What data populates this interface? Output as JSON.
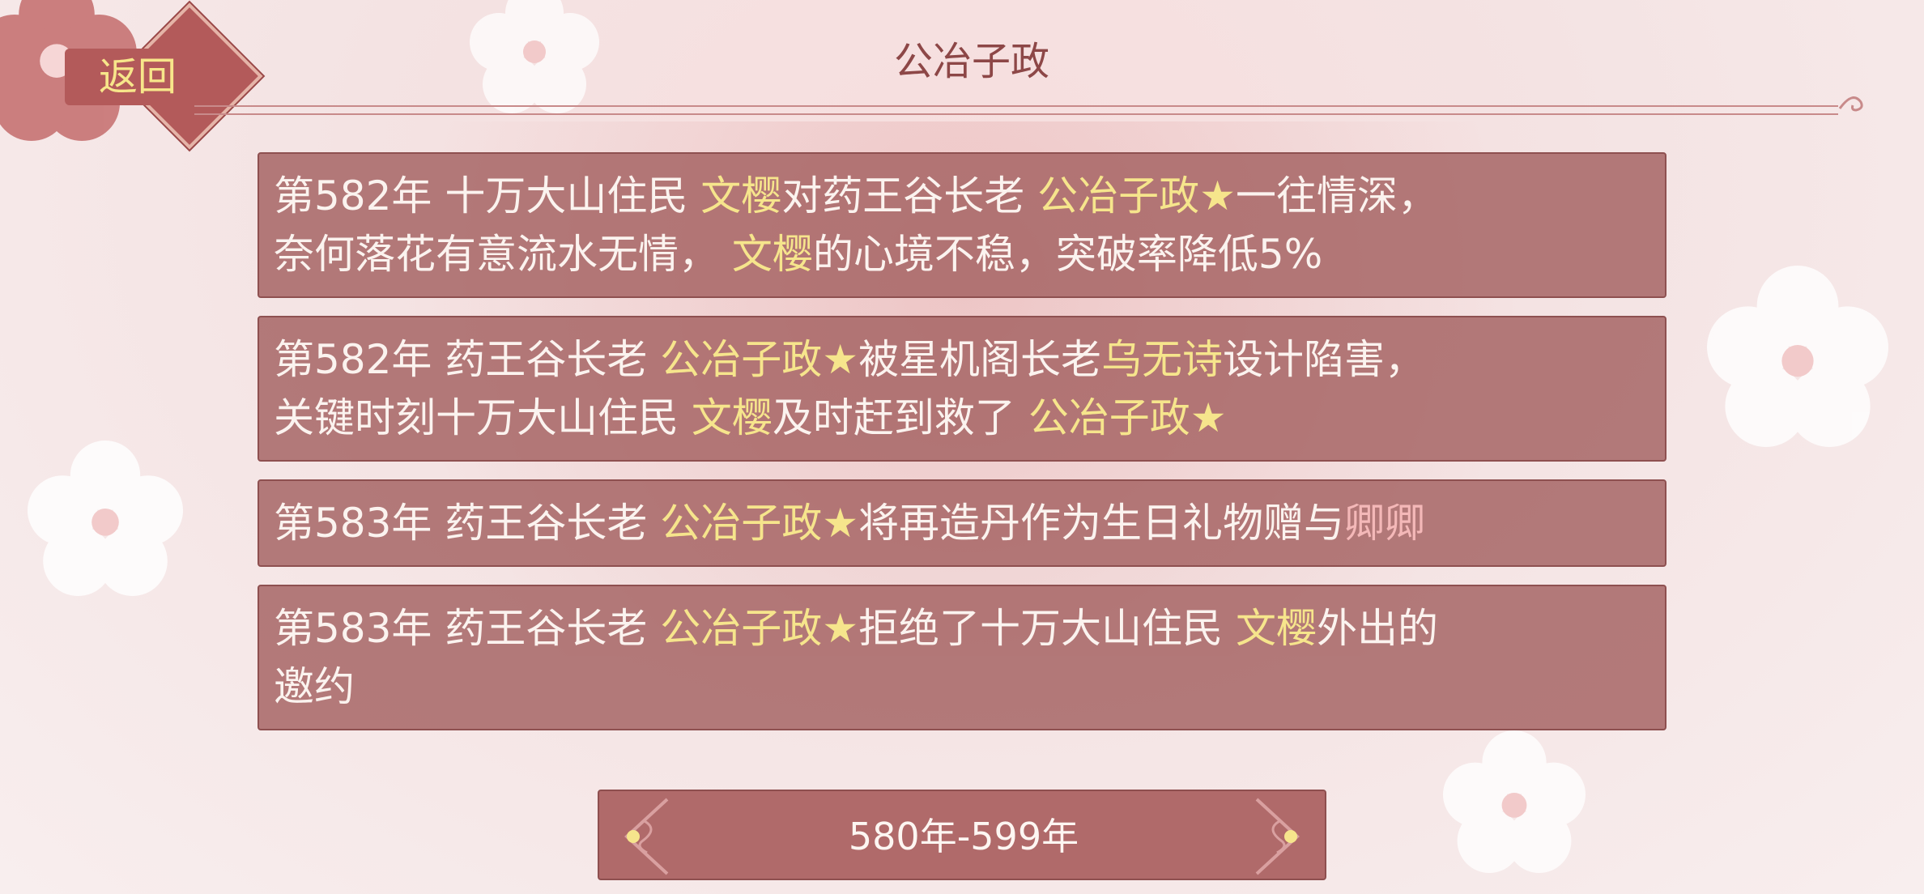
{
  "header": {
    "back_label": "返回",
    "title": "公冶子政"
  },
  "events": [
    {
      "parts": [
        {
          "text": "第582年 十万大山住民 ",
          "style": "plain"
        },
        {
          "text": "文樱",
          "style": "gold"
        },
        {
          "text": "对药王谷长老 ",
          "style": "plain"
        },
        {
          "text": "公冶子政★",
          "style": "gold"
        },
        {
          "text": "一往情深，",
          "style": "plain"
        },
        {
          "text": "\n",
          "style": "break"
        },
        {
          "text": "奈何落花有意流水无情， ",
          "style": "plain"
        },
        {
          "text": "文樱",
          "style": "gold"
        },
        {
          "text": "的心境不稳，突破率降低5%",
          "style": "plain"
        }
      ]
    },
    {
      "parts": [
        {
          "text": "第582年 药王谷长老 ",
          "style": "plain"
        },
        {
          "text": "公冶子政★",
          "style": "gold"
        },
        {
          "text": "被星机阁长老",
          "style": "plain"
        },
        {
          "text": "乌无诗",
          "style": "gold"
        },
        {
          "text": "设计陷害，",
          "style": "plain"
        },
        {
          "text": "\n",
          "style": "break"
        },
        {
          "text": "关键时刻十万大山住民 ",
          "style": "plain"
        },
        {
          "text": "文樱",
          "style": "gold"
        },
        {
          "text": "及时赶到救了 ",
          "style": "plain"
        },
        {
          "text": "公冶子政★",
          "style": "gold"
        }
      ]
    },
    {
      "parts": [
        {
          "text": "第583年 药王谷长老 ",
          "style": "plain"
        },
        {
          "text": "公冶子政★",
          "style": "gold"
        },
        {
          "text": "将再造丹作为生日礼物赠与",
          "style": "plain"
        },
        {
          "text": "卿卿",
          "style": "pink"
        }
      ]
    },
    {
      "parts": [
        {
          "text": "第583年 药王谷长老 ",
          "style": "plain"
        },
        {
          "text": "公冶子政★",
          "style": "gold"
        },
        {
          "text": "拒绝了十万大山住民 ",
          "style": "plain"
        },
        {
          "text": "文樱",
          "style": "gold"
        },
        {
          "text": "外出的",
          "style": "plain"
        },
        {
          "text": "\n",
          "style": "break"
        },
        {
          "text": "邀约",
          "style": "plain"
        }
      ]
    }
  ],
  "footer": {
    "year_range": "580年-599年"
  },
  "colors": {
    "highlight_gold": "#f6e58c",
    "highlight_pink": "#f4b8b8",
    "card_bg": "#a36060",
    "title": "#8d4747"
  }
}
